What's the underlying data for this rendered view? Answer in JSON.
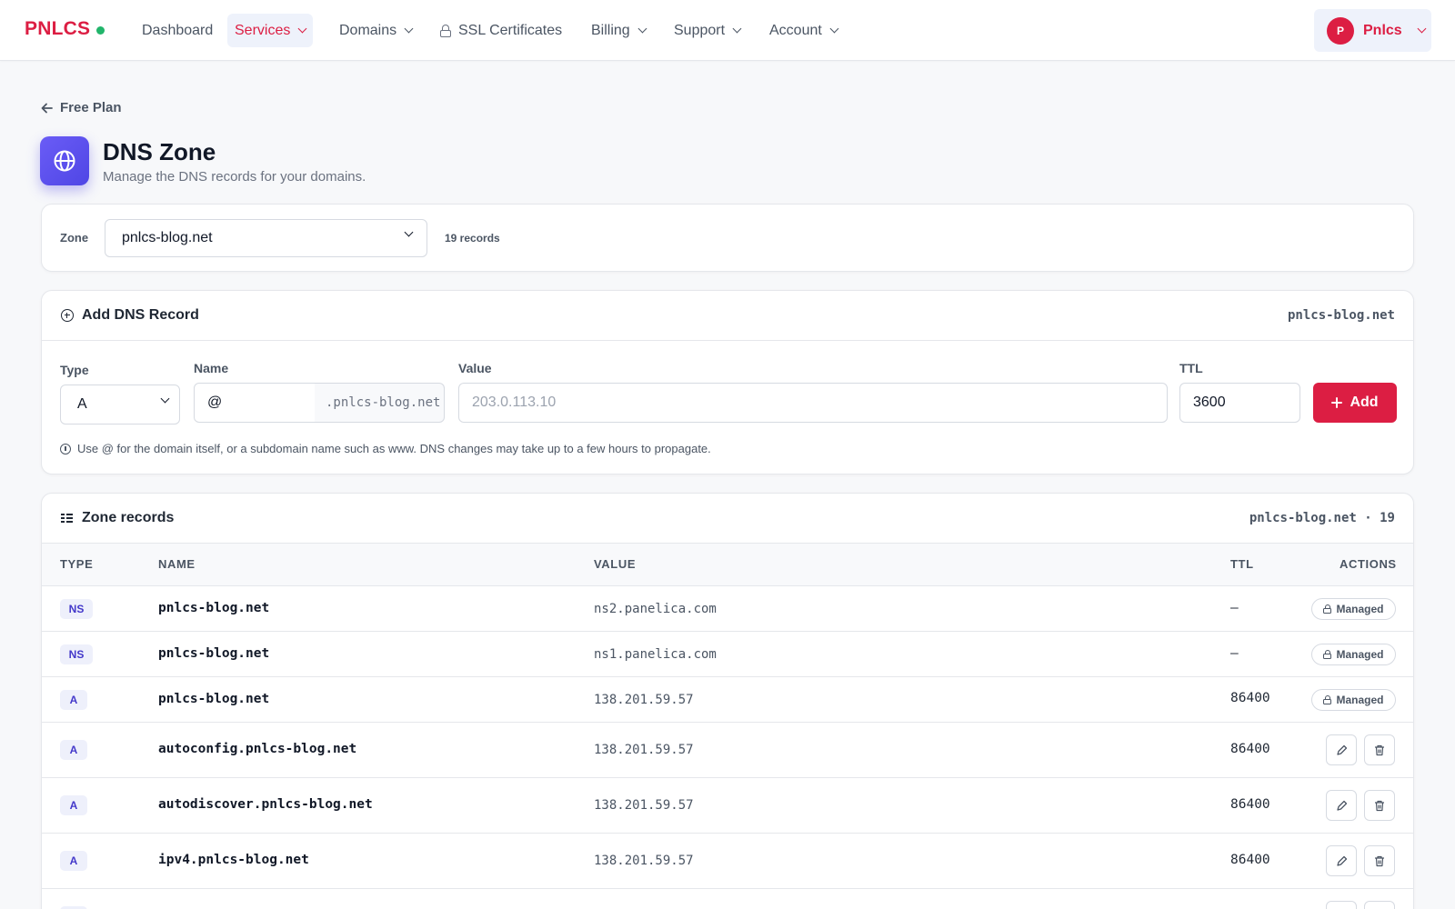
{
  "nav": {
    "brand": "PNLCS",
    "items": [
      {
        "label": "Dashboard"
      },
      {
        "label": "Services"
      },
      {
        "label": "Domains"
      },
      {
        "label": "SSL Certificates"
      },
      {
        "label": "Billing"
      },
      {
        "label": "Support"
      },
      {
        "label": "Account"
      }
    ],
    "active": "Services",
    "user": {
      "initial": "P",
      "name": "Pnlcs"
    }
  },
  "header": {
    "back_label": "Free Plan",
    "title": "DNS Zone",
    "subtitle": "Manage the DNS records for your domains."
  },
  "zone": {
    "label": "Zone",
    "selected": "pnlcs-blog.net",
    "count": "19 records"
  },
  "add_record": {
    "title": "Add DNS Record",
    "domain": "pnlcs-blog.net",
    "type_label": "Type",
    "type_value": "A",
    "name_label": "Name",
    "name_value": "@",
    "name_suffix": ".pnlcs-blog.net",
    "value_label": "Value",
    "value_placeholder": "203.0.113.10",
    "ttl_label": "TTL",
    "ttl_value": "3600",
    "add_label": "Add",
    "hint": "Use @ for the domain itself, or a subdomain name such as www. DNS changes may take up to a few hours to propagate."
  },
  "records": {
    "title": "Zone records",
    "summary": "pnlcs-blog.net · 19",
    "columns": {
      "type": "TYPE",
      "name": "NAME",
      "value": "VALUE",
      "ttl": "TTL",
      "actions": "ACTIONS"
    },
    "managed_label": "Managed",
    "rows": [
      {
        "type": "NS",
        "name": "pnlcs-blog.net",
        "value": "ns2.panelica.com",
        "ttl": "—",
        "managed": true
      },
      {
        "type": "NS",
        "name": "pnlcs-blog.net",
        "value": "ns1.panelica.com",
        "ttl": "—",
        "managed": true
      },
      {
        "type": "A",
        "name": "pnlcs-blog.net",
        "value": "138.201.59.57",
        "ttl": "86400",
        "managed": true
      },
      {
        "type": "A",
        "name": "autoconfig.pnlcs-blog.net",
        "value": "138.201.59.57",
        "ttl": "86400",
        "managed": false
      },
      {
        "type": "A",
        "name": "autodiscover.pnlcs-blog.net",
        "value": "138.201.59.57",
        "ttl": "86400",
        "managed": false
      },
      {
        "type": "A",
        "name": "ipv4.pnlcs-blog.net",
        "value": "138.201.59.57",
        "ttl": "86400",
        "managed": false
      }
    ]
  },
  "colors": {
    "brand": "#dc1e43",
    "accent": "#4f46e5",
    "status_dot": "#21b56b"
  }
}
